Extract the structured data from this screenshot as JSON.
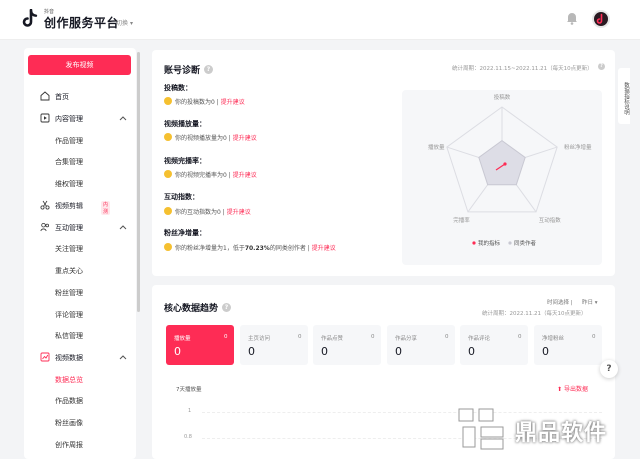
{
  "header": {
    "logo_small": "抖音",
    "title": "创作服务平台",
    "switch_label": "切换"
  },
  "sidebar": {
    "publish_label": "发布视频",
    "items": {
      "home": "首页",
      "content": "内容管理",
      "works": "作品管理",
      "collection": "合集管理",
      "rights": "维权管理",
      "video_edit": "视频剪辑",
      "video_edit_badge": "内测",
      "interaction": "互动管理",
      "follow": "关注管理",
      "care": "重点关心",
      "fans": "粉丝管理",
      "comments": "评论管理",
      "messages": "私信管理",
      "video_data": "视频数据",
      "data_overview": "数据总览",
      "works_data": "作品数据",
      "fan_profile": "粉丝画像",
      "weekly": "创作周报"
    }
  },
  "diagnosis": {
    "title": "账号诊断",
    "period": "统计周期：2022.11.15~2022.11.21（每天10点更新）",
    "link_label": "提升建议",
    "rows": [
      {
        "label": "投稿数：",
        "text_pre": "你的投稿数为",
        "value": "0",
        "text_post": ""
      },
      {
        "label": "视频播放量：",
        "text_pre": "你的视频播放量为",
        "value": "0",
        "text_post": ""
      },
      {
        "label": "视频完播率：",
        "text_pre": "你的视频完播率为",
        "value": "0",
        "text_post": ""
      },
      {
        "label": "互动指数：",
        "text_pre": "你的互动指数为",
        "value": "0",
        "text_post": ""
      },
      {
        "label": "粉丝净增量：",
        "text_pre": "你的粉丝净增量为1，低于",
        "value": "70.23%",
        "text_post": "的同类创作者"
      }
    ],
    "radar": {
      "axes": [
        "投稿数",
        "粉丝净增量",
        "互动指数",
        "完播率",
        "播放量"
      ],
      "legend": [
        "我的指标",
        "同类作者"
      ],
      "my_color": "#fe2c55",
      "peer_color": "#c8c8d2"
    }
  },
  "trend": {
    "title": "核心数据趋势",
    "time_select": "时间选择",
    "time_value": "昨日",
    "period": "统计周期：2022.11.21（每天10点更新）",
    "metrics": [
      {
        "label": "播放量",
        "zero": "0",
        "value": "0"
      },
      {
        "label": "主页访问",
        "zero": "0",
        "value": "0"
      },
      {
        "label": "作品点赞",
        "zero": "0",
        "value": "0"
      },
      {
        "label": "作品分享",
        "zero": "0",
        "value": "0"
      },
      {
        "label": "作品评论",
        "zero": "0",
        "value": "0"
      },
      {
        "label": "净增粉丝",
        "zero": "0",
        "value": "0"
      }
    ],
    "chart_title": "7天播放量",
    "export_label": "导出数据",
    "y_ticks": [
      "1",
      "0.8"
    ]
  },
  "side_tab": "数据指标说明",
  "float_help": "?",
  "watermark": "鼎品软件",
  "colors": {
    "accent": "#fe2c55"
  }
}
